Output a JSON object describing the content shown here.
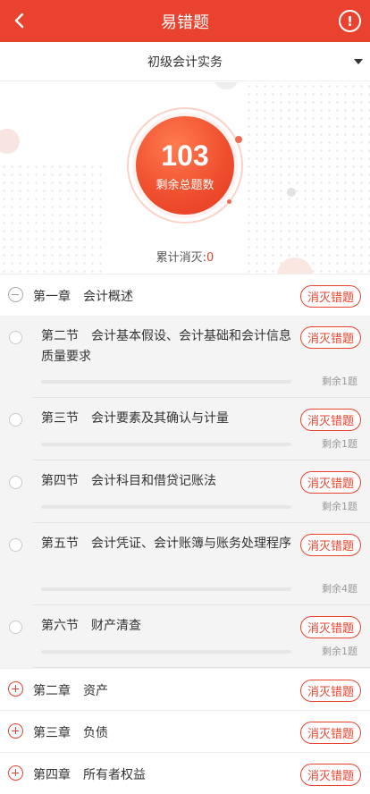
{
  "header": {
    "title": "易错题"
  },
  "subject": {
    "name": "初级会计实务"
  },
  "stats": {
    "count": "103",
    "count_label": "剩余总题数",
    "cumulative_label": "累计消灭:",
    "cumulative_value": "0"
  },
  "action_label": "消灭错题",
  "chapters": [
    {
      "title": "第一章　会计概述",
      "expanded": true,
      "sections": [
        {
          "title": "第二节　会计基本假设、会计基础和会计信息质量要求",
          "remaining": "剩余1题",
          "progress": 0
        },
        {
          "title": "第三节　会计要素及其确认与计量",
          "remaining": "剩余1题",
          "progress": 0
        },
        {
          "title": "第四节　会计科目和借贷记账法",
          "remaining": "剩余1题",
          "progress": 0
        },
        {
          "title": "第五节　会计凭证、会计账簿与账务处理程序",
          "remaining": "剩余4题",
          "progress": 0
        },
        {
          "title": "第六节　财产清查",
          "remaining": "剩余1题",
          "progress": 0
        }
      ]
    },
    {
      "title": "第二章　资产",
      "expanded": false
    },
    {
      "title": "第三章　负债",
      "expanded": false
    },
    {
      "title": "第四章　所有者权益",
      "expanded": false
    }
  ],
  "colors": {
    "accent": "#e9432f"
  },
  "icons": {
    "back": "chevron-left-icon",
    "info": "info-icon",
    "dropdown": "caret-down-icon"
  }
}
